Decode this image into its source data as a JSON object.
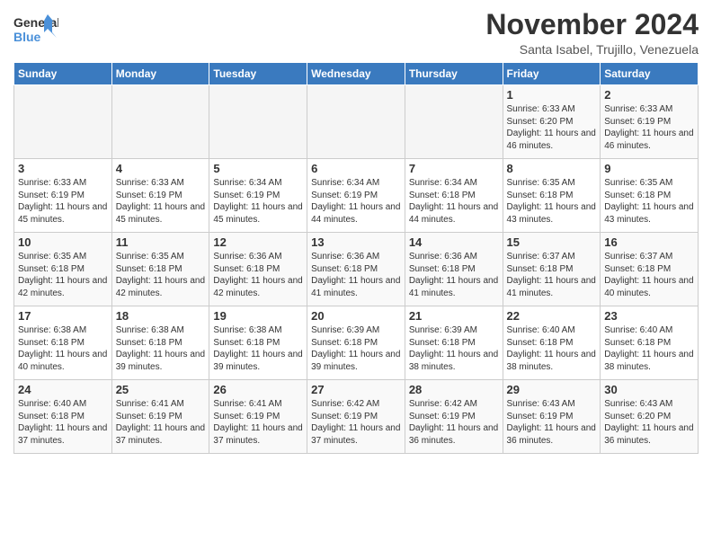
{
  "logo": {
    "line1": "General",
    "line2": "Blue"
  },
  "title": "November 2024",
  "subtitle": "Santa Isabel, Trujillo, Venezuela",
  "weekdays": [
    "Sunday",
    "Monday",
    "Tuesday",
    "Wednesday",
    "Thursday",
    "Friday",
    "Saturday"
  ],
  "weeks": [
    [
      {
        "day": "",
        "info": ""
      },
      {
        "day": "",
        "info": ""
      },
      {
        "day": "",
        "info": ""
      },
      {
        "day": "",
        "info": ""
      },
      {
        "day": "",
        "info": ""
      },
      {
        "day": "1",
        "info": "Sunrise: 6:33 AM\nSunset: 6:20 PM\nDaylight: 11 hours and 46 minutes."
      },
      {
        "day": "2",
        "info": "Sunrise: 6:33 AM\nSunset: 6:19 PM\nDaylight: 11 hours and 46 minutes."
      }
    ],
    [
      {
        "day": "3",
        "info": "Sunrise: 6:33 AM\nSunset: 6:19 PM\nDaylight: 11 hours and 45 minutes."
      },
      {
        "day": "4",
        "info": "Sunrise: 6:33 AM\nSunset: 6:19 PM\nDaylight: 11 hours and 45 minutes."
      },
      {
        "day": "5",
        "info": "Sunrise: 6:34 AM\nSunset: 6:19 PM\nDaylight: 11 hours and 45 minutes."
      },
      {
        "day": "6",
        "info": "Sunrise: 6:34 AM\nSunset: 6:19 PM\nDaylight: 11 hours and 44 minutes."
      },
      {
        "day": "7",
        "info": "Sunrise: 6:34 AM\nSunset: 6:18 PM\nDaylight: 11 hours and 44 minutes."
      },
      {
        "day": "8",
        "info": "Sunrise: 6:35 AM\nSunset: 6:18 PM\nDaylight: 11 hours and 43 minutes."
      },
      {
        "day": "9",
        "info": "Sunrise: 6:35 AM\nSunset: 6:18 PM\nDaylight: 11 hours and 43 minutes."
      }
    ],
    [
      {
        "day": "10",
        "info": "Sunrise: 6:35 AM\nSunset: 6:18 PM\nDaylight: 11 hours and 42 minutes."
      },
      {
        "day": "11",
        "info": "Sunrise: 6:35 AM\nSunset: 6:18 PM\nDaylight: 11 hours and 42 minutes."
      },
      {
        "day": "12",
        "info": "Sunrise: 6:36 AM\nSunset: 6:18 PM\nDaylight: 11 hours and 42 minutes."
      },
      {
        "day": "13",
        "info": "Sunrise: 6:36 AM\nSunset: 6:18 PM\nDaylight: 11 hours and 41 minutes."
      },
      {
        "day": "14",
        "info": "Sunrise: 6:36 AM\nSunset: 6:18 PM\nDaylight: 11 hours and 41 minutes."
      },
      {
        "day": "15",
        "info": "Sunrise: 6:37 AM\nSunset: 6:18 PM\nDaylight: 11 hours and 41 minutes."
      },
      {
        "day": "16",
        "info": "Sunrise: 6:37 AM\nSunset: 6:18 PM\nDaylight: 11 hours and 40 minutes."
      }
    ],
    [
      {
        "day": "17",
        "info": "Sunrise: 6:38 AM\nSunset: 6:18 PM\nDaylight: 11 hours and 40 minutes."
      },
      {
        "day": "18",
        "info": "Sunrise: 6:38 AM\nSunset: 6:18 PM\nDaylight: 11 hours and 39 minutes."
      },
      {
        "day": "19",
        "info": "Sunrise: 6:38 AM\nSunset: 6:18 PM\nDaylight: 11 hours and 39 minutes."
      },
      {
        "day": "20",
        "info": "Sunrise: 6:39 AM\nSunset: 6:18 PM\nDaylight: 11 hours and 39 minutes."
      },
      {
        "day": "21",
        "info": "Sunrise: 6:39 AM\nSunset: 6:18 PM\nDaylight: 11 hours and 38 minutes."
      },
      {
        "day": "22",
        "info": "Sunrise: 6:40 AM\nSunset: 6:18 PM\nDaylight: 11 hours and 38 minutes."
      },
      {
        "day": "23",
        "info": "Sunrise: 6:40 AM\nSunset: 6:18 PM\nDaylight: 11 hours and 38 minutes."
      }
    ],
    [
      {
        "day": "24",
        "info": "Sunrise: 6:40 AM\nSunset: 6:18 PM\nDaylight: 11 hours and 37 minutes."
      },
      {
        "day": "25",
        "info": "Sunrise: 6:41 AM\nSunset: 6:19 PM\nDaylight: 11 hours and 37 minutes."
      },
      {
        "day": "26",
        "info": "Sunrise: 6:41 AM\nSunset: 6:19 PM\nDaylight: 11 hours and 37 minutes."
      },
      {
        "day": "27",
        "info": "Sunrise: 6:42 AM\nSunset: 6:19 PM\nDaylight: 11 hours and 37 minutes."
      },
      {
        "day": "28",
        "info": "Sunrise: 6:42 AM\nSunset: 6:19 PM\nDaylight: 11 hours and 36 minutes."
      },
      {
        "day": "29",
        "info": "Sunrise: 6:43 AM\nSunset: 6:19 PM\nDaylight: 11 hours and 36 minutes."
      },
      {
        "day": "30",
        "info": "Sunrise: 6:43 AM\nSunset: 6:20 PM\nDaylight: 11 hours and 36 minutes."
      }
    ]
  ]
}
